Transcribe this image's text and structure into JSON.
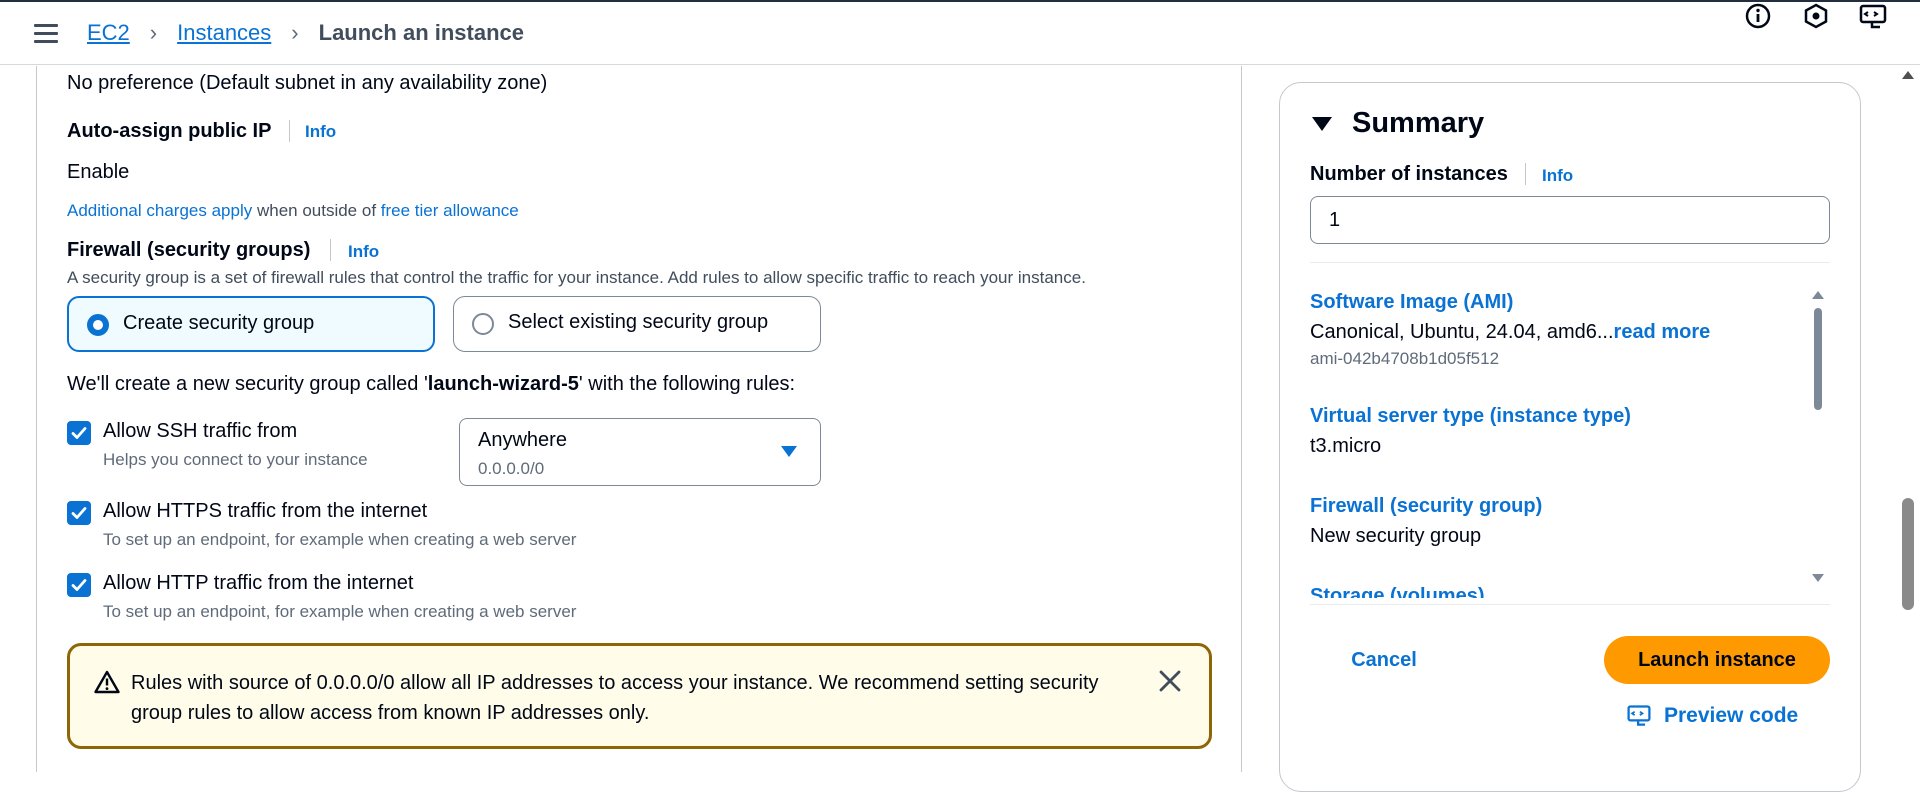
{
  "header": {
    "breadcrumbs": [
      "EC2",
      "Instances",
      "Launch an instance"
    ],
    "icons": [
      "info-icon",
      "settings-hex-icon",
      "preview-code-icon"
    ]
  },
  "network": {
    "subnet_value": "No preference (Default subnet in any availability zone)",
    "auto_ip_label": "Auto-assign public IP",
    "auto_ip_info": "Info",
    "auto_ip_value": "Enable",
    "charges_link": "Additional charges apply",
    "charges_mid": " when outside of ",
    "free_tier_link": "free tier allowance"
  },
  "firewall": {
    "label": "Firewall (security groups)",
    "info": "Info",
    "description": "A security group is a set of firewall rules that control the traffic for your instance. Add rules to allow specific traffic to reach your instance.",
    "options": [
      "Create security group",
      "Select existing security group"
    ],
    "selected_option": "Create security group",
    "rules_intro_pre": "We'll create a new security group called '",
    "group_name": "launch-wizard-5",
    "rules_intro_post": "' with the following rules:",
    "rules": [
      {
        "label": "Allow SSH traffic from",
        "desc": "Helps you connect to your instance",
        "checked": true
      },
      {
        "label": "Allow HTTPS traffic from the internet",
        "desc": "To set up an endpoint, for example when creating a web server",
        "checked": true
      },
      {
        "label": "Allow HTTP traffic from the internet",
        "desc": "To set up an endpoint, for example when creating a web server",
        "checked": true
      }
    ],
    "ssh_source": {
      "value": "Anywhere",
      "sub": "0.0.0.0/0"
    }
  },
  "alert": {
    "message": "Rules with source of 0.0.0.0/0 allow all IP addresses to access your instance. We recommend setting security group rules to allow access from known IP addresses only."
  },
  "summary": {
    "title": "Summary",
    "num_instances_label": "Number of instances",
    "num_instances_info": "Info",
    "num_instances_value": "1",
    "ami_title": "Software Image (AMI)",
    "ami_value": "Canonical, Ubuntu, 24.04, amd6...",
    "ami_read_more": "read more",
    "ami_id": "ami-042b4708b1d05f512",
    "type_title": "Virtual server type (instance type)",
    "type_value": "t3.micro",
    "firewall_title": "Firewall (security group)",
    "firewall_value": "New security group",
    "storage_title": "Storage (volumes)",
    "cancel": "Cancel",
    "launch": "Launch instance",
    "preview": "Preview code"
  },
  "colors": {
    "accent": "#0972d3",
    "launch": "#ff9900",
    "warning_border": "#8d6605",
    "warning_bg": "#fffce9"
  }
}
